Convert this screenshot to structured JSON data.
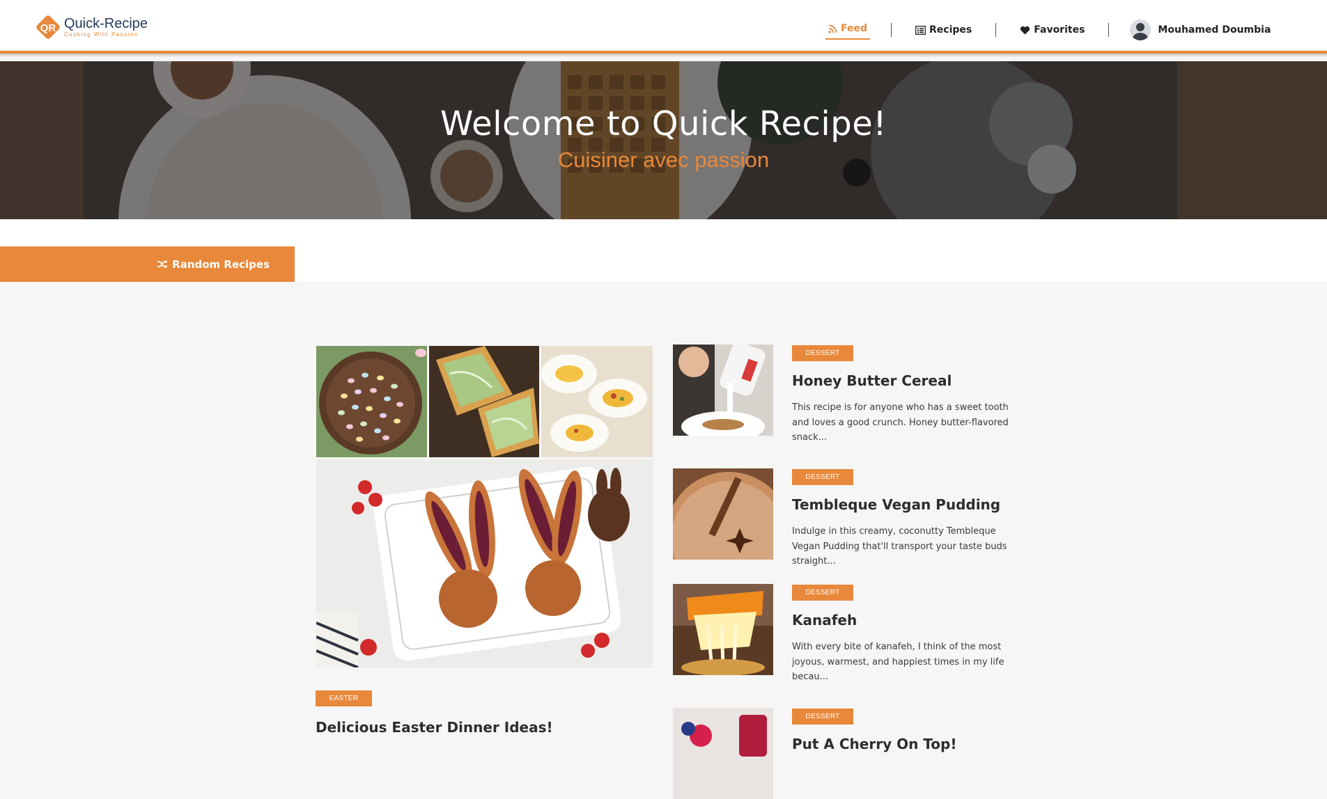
{
  "header": {
    "logo_title": "Quick-Recipe",
    "logo_tagline": "Cooking With Passion",
    "nav": [
      {
        "label": "Feed",
        "icon": "rss-icon",
        "active": true
      },
      {
        "label": "Recipes",
        "icon": "list-icon",
        "active": false
      },
      {
        "label": "Favorites",
        "icon": "heart-icon",
        "active": false
      }
    ],
    "user_name": "Mouhamed Doumbia"
  },
  "hero": {
    "title": "Welcome to Quick Recipe!",
    "subtitle": "Cuisiner avec passion"
  },
  "random_button": {
    "label": "Random Recipes",
    "icon": "shuffle-icon"
  },
  "featured": {
    "badge": "EASTER",
    "title": "Delicious Easter Dinner Ideas!"
  },
  "recipes": [
    {
      "category": "DESSERT",
      "title": "Honey Butter Cereal",
      "description": "This recipe is for anyone who has a sweet tooth and loves a good crunch. Honey butter-flavored snack..."
    },
    {
      "category": "DESSERT",
      "title": "Tembleque Vegan Pudding",
      "description": "Indulge in this creamy, coconutty Tembleque Vegan Pudding that'll transport your taste buds straight..."
    },
    {
      "category": "DESSERT",
      "title": "Kanafeh",
      "description": "With every bite of kanafeh, I think of the most joyous, warmest, and happiest times in my life becau..."
    },
    {
      "category": "DESSERT",
      "title": "Put A Cherry On Top!",
      "description": ""
    }
  ],
  "colors": {
    "accent": "#e8883a",
    "navy": "#253a5e",
    "text": "#2d2d2d",
    "background": "#f6f6f7"
  }
}
